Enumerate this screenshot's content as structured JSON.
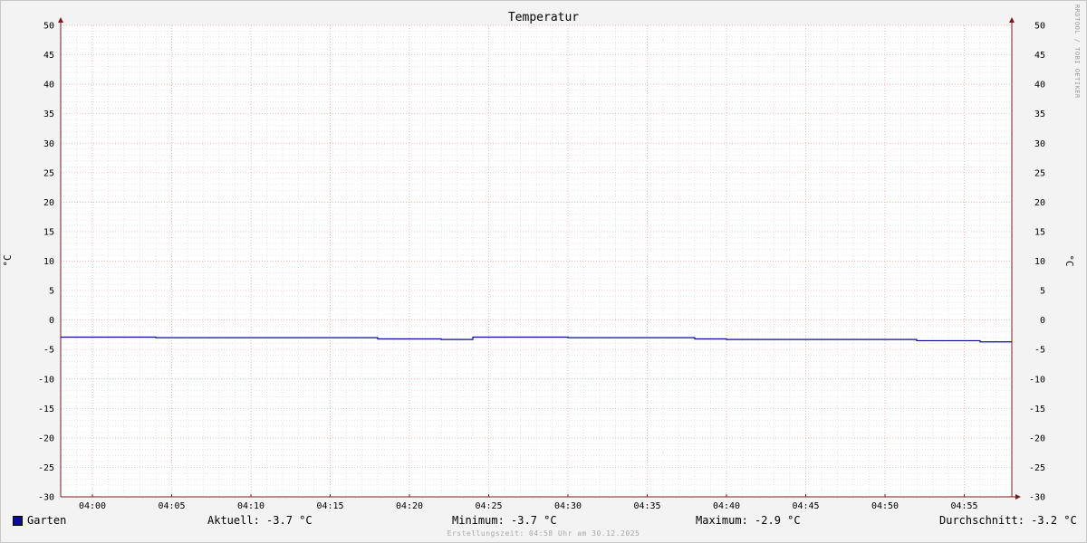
{
  "chart_data": {
    "type": "line",
    "title": "Temperatur",
    "ylabel": "°C",
    "ylabel_right": "°C",
    "ylim": [
      -30,
      50
    ],
    "yticks": [
      50,
      45,
      40,
      35,
      30,
      25,
      20,
      15,
      10,
      5,
      0,
      -5,
      -10,
      -15,
      -20,
      -25,
      -30
    ],
    "xlim": [
      "03:58",
      "04:58"
    ],
    "xticks": [
      "04:00",
      "04:05",
      "04:10",
      "04:15",
      "04:20",
      "04:25",
      "04:30",
      "04:35",
      "04:40",
      "04:45",
      "04:50",
      "04:55"
    ],
    "grid": true,
    "legend_position": "bottom-left",
    "series": [
      {
        "name": "Garten",
        "color": "#0a0a9c",
        "x": [
          "03:58",
          "04:04",
          "04:04",
          "04:18",
          "04:18",
          "04:22",
          "04:22",
          "04:24",
          "04:24",
          "04:30",
          "04:30",
          "04:38",
          "04:38",
          "04:40",
          "04:40",
          "04:52",
          "04:52",
          "04:56",
          "04:56",
          "04:58"
        ],
        "y": [
          -2.9,
          -2.9,
          -3.0,
          -3.0,
          -3.2,
          -3.2,
          -3.3,
          -3.3,
          -2.9,
          -2.9,
          -3.0,
          -3.0,
          -3.2,
          -3.2,
          -3.3,
          -3.3,
          -3.5,
          -3.5,
          -3.7,
          -3.7
        ]
      }
    ]
  },
  "legend": {
    "series_label": "Garten",
    "aktuell": "Aktuell: -3.7 °C",
    "minimum": "Minimum: -3.7 °C",
    "maximum": "Maximum: -2.9 °C",
    "durchschnitt": "Durchschnitt: -3.2 °C"
  },
  "footer": {
    "created": "Erstellungszeit: 04:58 Uhr am 30.12.2025"
  },
  "watermark": "RRDTOOL / TOBI OETIKER",
  "colors": {
    "background": "#f3f3f3",
    "plot": "#ffffff",
    "major_grid": "#e8a0a0",
    "minor_grid": "#d6d6d6",
    "axis": "#7a1c1c"
  }
}
